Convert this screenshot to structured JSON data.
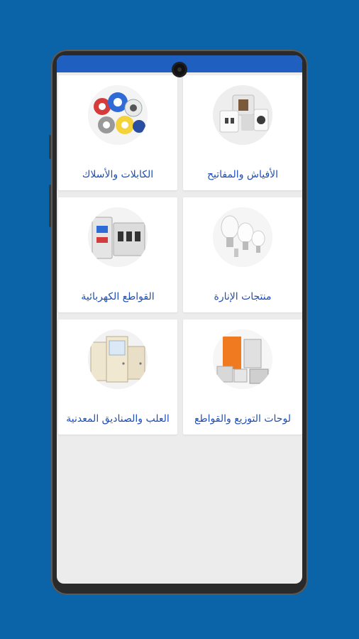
{
  "categories": [
    {
      "label": "الأفياش والمفاتيح",
      "icon": "socket-switch-icon"
    },
    {
      "label": "الكابلات والأسلاك",
      "icon": "cable-reels-icon"
    },
    {
      "label": "منتجات الإنارة",
      "icon": "light-bulb-icon"
    },
    {
      "label": "القواطع الكهربائية",
      "icon": "circuit-breaker-icon"
    },
    {
      "label": "لوحات التوزيع والقواطع",
      "icon": "distribution-board-icon"
    },
    {
      "label": "العلب والصناديق المعدنية",
      "icon": "metal-box-icon"
    }
  ],
  "colors": {
    "background": "#0b64a8",
    "app_bar": "#1f5fbf",
    "label": "#1f4fb5",
    "screen": "#ececec"
  }
}
